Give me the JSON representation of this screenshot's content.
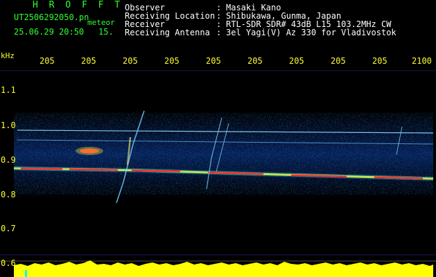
{
  "header": {
    "title": "H R O F F T",
    "filename": "UT2506292050.pn",
    "meteor_label": "meteor",
    "datetime": "25.06.29 20:50",
    "count": "15."
  },
  "meta": [
    {
      "label": "Observer",
      "value": "Masaki Kano"
    },
    {
      "label": "Receiving Location",
      "value": "Shibukawa, Gunma, Japan"
    },
    {
      "label": "Receiver",
      "value": "RTL-SDR SDR# 43dB L15 103.2MHz CW"
    },
    {
      "label": "Receiving Antenna",
      "value": "3el Yagi(V) Az 330 for Vladivostok"
    }
  ],
  "meta_separator": ":",
  "axis": {
    "y_unit": "kHz",
    "x_ticks": [
      "205",
      "205",
      "205",
      "205",
      "205",
      "205",
      "205",
      "205",
      "205",
      "2100"
    ],
    "y_ticks": [
      "1.1",
      "1.0",
      "0.9",
      "0.8",
      "0.7",
      "0.6"
    ]
  },
  "colors": {
    "background": "#000000",
    "label_green": "#2fff2f",
    "axis_yellow": "#ffff33",
    "signal_red": "#ff2020",
    "spectrum_yellow": "#ffff00"
  }
}
